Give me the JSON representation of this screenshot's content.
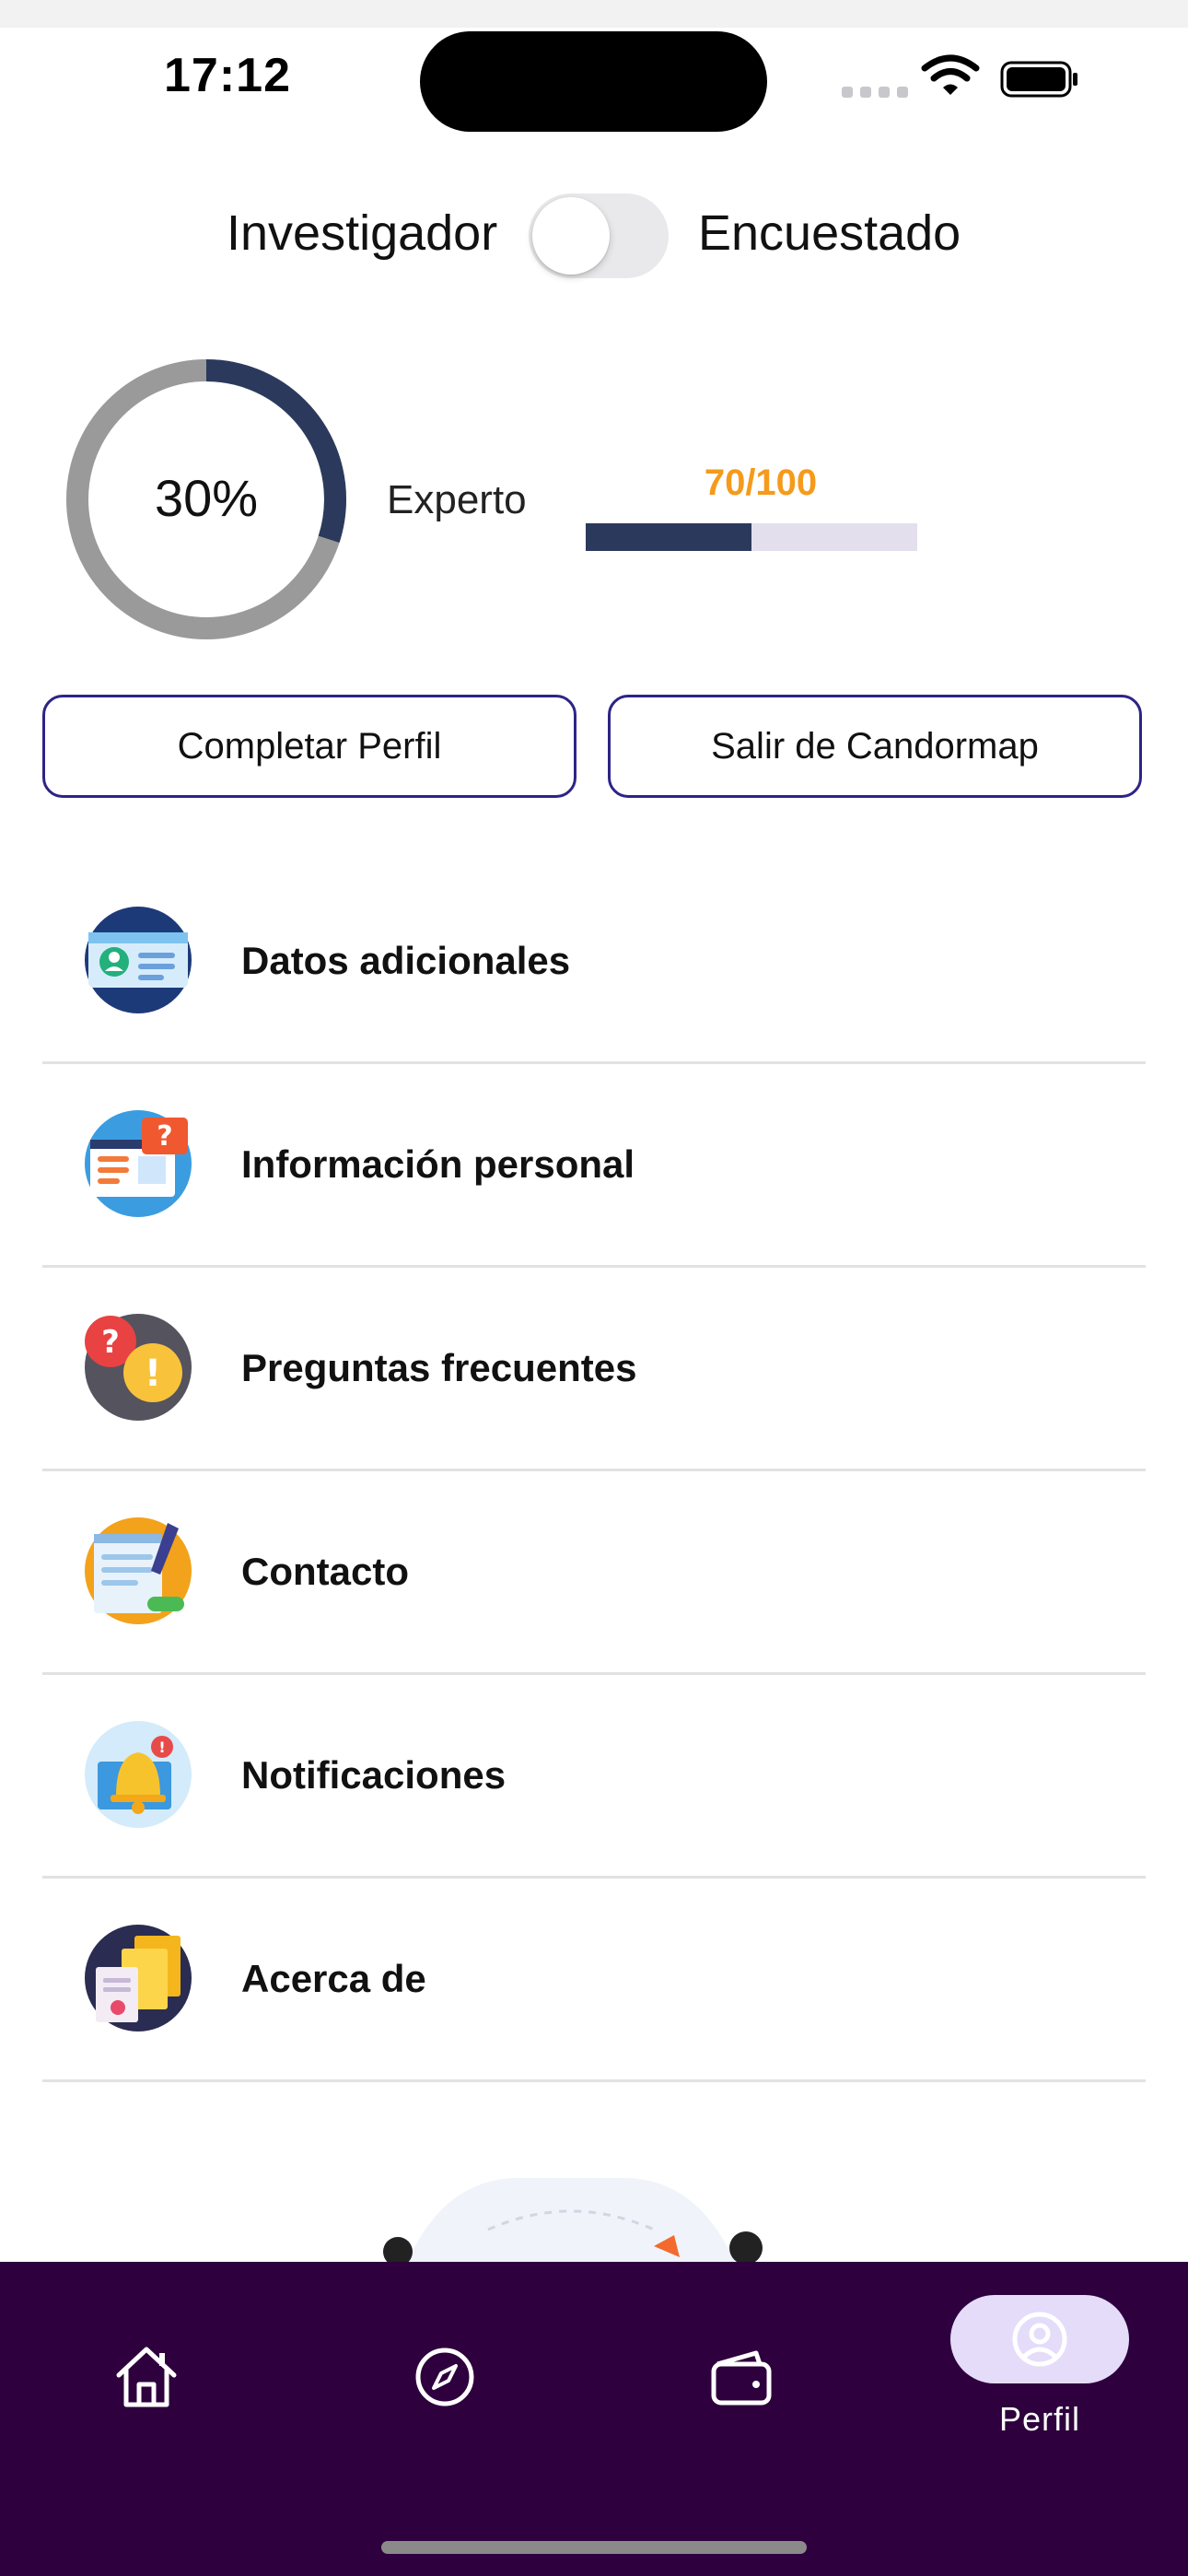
{
  "status_bar": {
    "time": "17:12"
  },
  "role_toggle": {
    "left_label": "Investigador",
    "right_label": "Encuestado",
    "is_on": false
  },
  "profile": {
    "completion_text": "30%",
    "completion_fraction": 0.3,
    "level_label": "Experto",
    "score_text": "70/100",
    "score_fraction": 0.5
  },
  "buttons": {
    "complete_profile": "Completar Perfil",
    "exit": "Salir de Candormap"
  },
  "menu": [
    {
      "label": "Datos adicionales",
      "icon": "id-card-icon"
    },
    {
      "label": "Información personal",
      "icon": "personal-info-icon"
    },
    {
      "label": "Preguntas frecuentes",
      "icon": "faq-icon"
    },
    {
      "label": "Contacto",
      "icon": "contact-form-icon"
    },
    {
      "label": "Notificaciones",
      "icon": "bell-icon"
    },
    {
      "label": "Acerca de",
      "icon": "documents-icon"
    }
  ],
  "bottom_nav": {
    "items": [
      {
        "icon": "home-icon"
      },
      {
        "icon": "compass-icon"
      },
      {
        "icon": "wallet-icon"
      },
      {
        "icon": "profile-icon",
        "label": "Perfil",
        "active": true
      }
    ]
  },
  "colors": {
    "accent_dark": "#2e003d",
    "progress_navy": "#2b3a5c",
    "score_orange": "#f59a1b",
    "button_border": "#2d2487",
    "active_pill": "#e5dcfa"
  }
}
